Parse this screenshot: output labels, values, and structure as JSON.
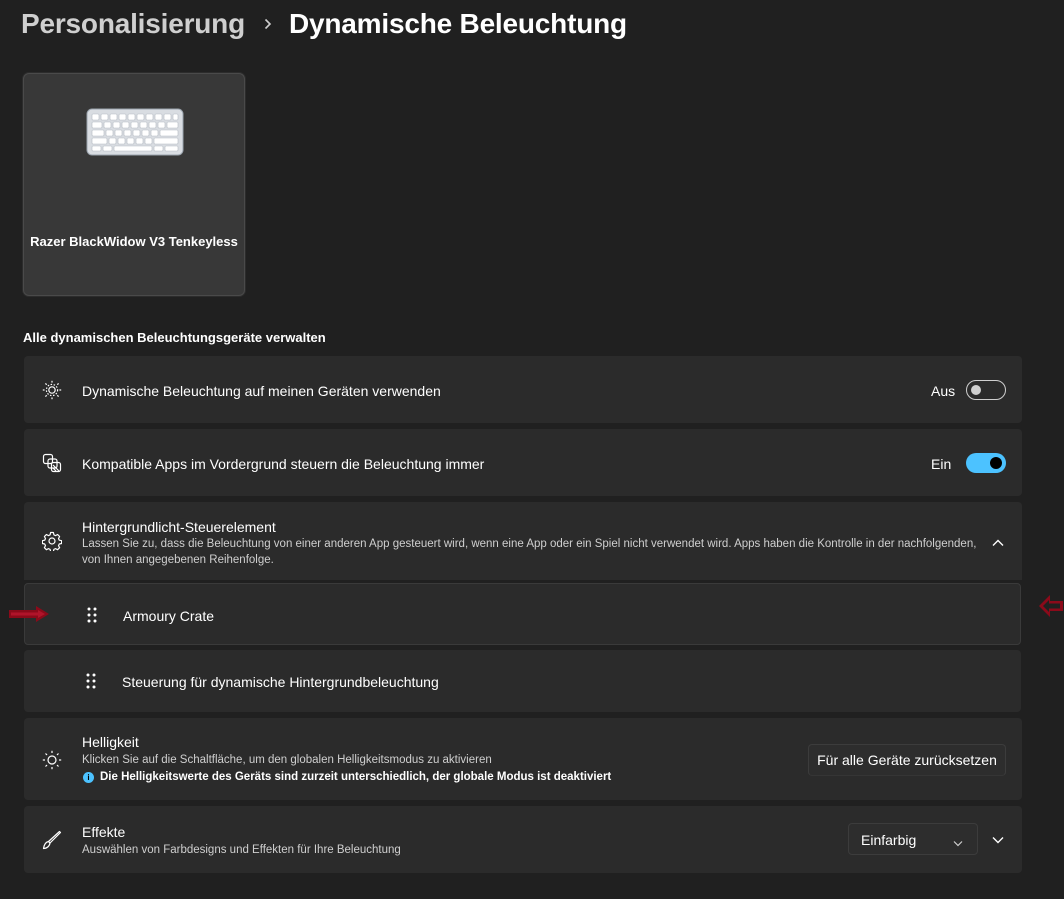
{
  "breadcrumb": {
    "parent": "Personalisierung",
    "separator_icon": "chevron-right-icon",
    "current": "Dynamische Beleuchtung"
  },
  "device": {
    "name": "Razer BlackWidow V3 Tenkeyless",
    "icon": "keyboard-icon"
  },
  "section": {
    "heading": "Alle dynamischen Beleuchtungsgeräte verwalten"
  },
  "settings": {
    "use_lighting": {
      "icon": "dynamic-lighting-icon",
      "title": "Dynamische Beleuchtung auf meinen Geräten verwenden",
      "state_label": "Aus",
      "state": false
    },
    "foreground_apps": {
      "icon": "apps-icon",
      "title": "Kompatible Apps im Vordergrund steuern die Beleuchtung immer",
      "state_label": "Ein",
      "state": true
    },
    "background_control": {
      "icon": "gear-icon",
      "title": "Hintergrundlicht-Steuerelement",
      "description": "Lassen Sie zu, dass die Beleuchtung von einer anderen App gesteuert wird, wenn eine App oder ein Spiel nicht verwendet wird. Apps haben die Kontrolle in der nachfolgenden, von Ihnen angegebenen Reihenfolge.",
      "expanded": true,
      "items": [
        {
          "label": "Armoury Crate"
        },
        {
          "label": "Steuerung für dynamische Hintergrundbeleuchtung"
        }
      ]
    },
    "brightness": {
      "icon": "sun-icon",
      "title": "Helligkeit",
      "description": "Klicken Sie auf die Schaltfläche, um den globalen Helligkeitsmodus zu aktivieren",
      "info": "Die Helligkeitswerte des Geräts sind zurzeit unterschiedlich, der globale Modus ist deaktiviert",
      "button_label": "Für alle Geräte zurücksetzen"
    },
    "effects": {
      "icon": "brush-icon",
      "title": "Effekte",
      "description": "Auswählen von Farbdesigns und Effekten für Ihre Beleuchtung",
      "selected": "Einfarbig"
    }
  },
  "colors": {
    "background": "#202020",
    "card": "#2b2b2b",
    "accent": "#4cc2ff",
    "annotation_arrow": "#8b0a1a"
  }
}
